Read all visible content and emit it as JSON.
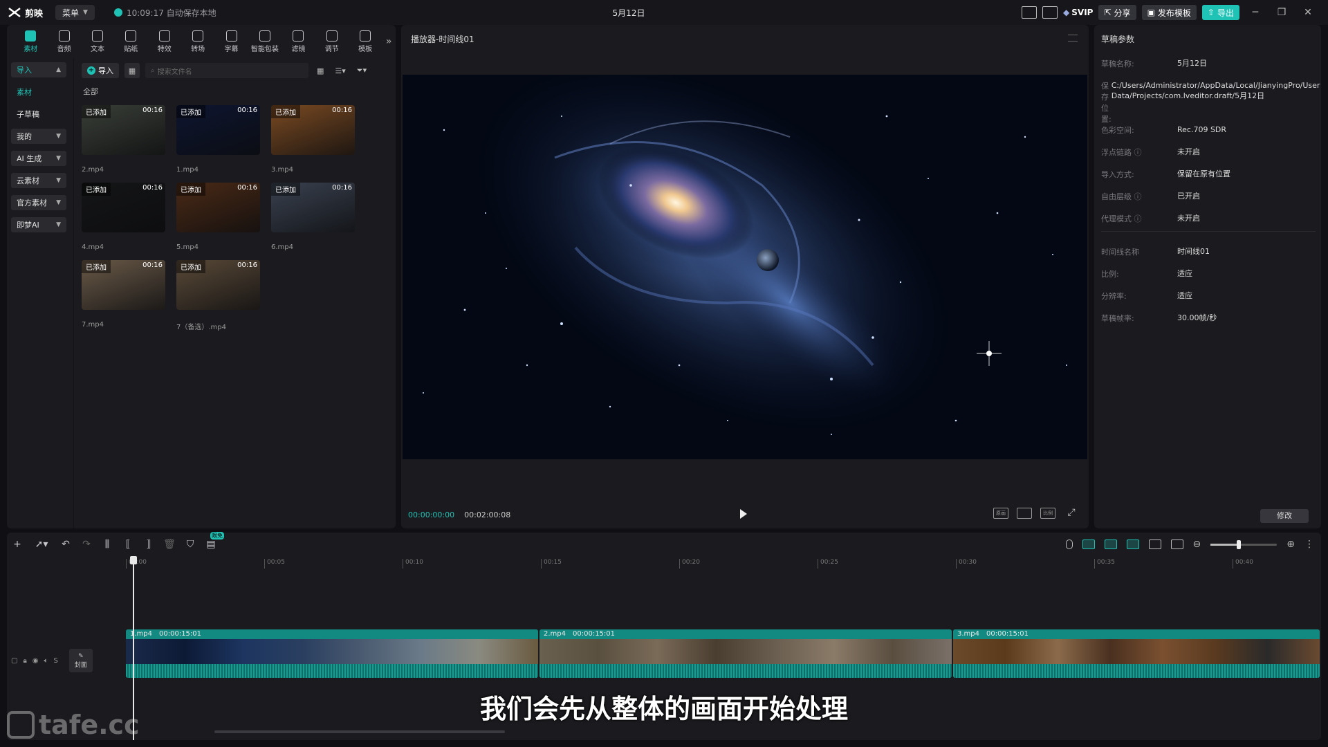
{
  "titlebar": {
    "app_name": "剪映",
    "menu_label": "菜单",
    "autosave": "10:09:17 自动保存本地",
    "title": "5月12日",
    "svip": "SVIP",
    "share": "分享",
    "publish_template": "发布模板",
    "export": "导出"
  },
  "tool_tabs": [
    {
      "label": "素材",
      "icon": "media-icon",
      "active": true
    },
    {
      "label": "音频",
      "icon": "audio-icon"
    },
    {
      "label": "文本",
      "icon": "text-icon"
    },
    {
      "label": "贴纸",
      "icon": "sticker-icon"
    },
    {
      "label": "特效",
      "icon": "effects-icon"
    },
    {
      "label": "转场",
      "icon": "transition-icon"
    },
    {
      "label": "字幕",
      "icon": "caption-icon"
    },
    {
      "label": "智能包装",
      "icon": "smart-pack-icon"
    },
    {
      "label": "滤镜",
      "icon": "filter-icon"
    },
    {
      "label": "调节",
      "icon": "adjust-icon"
    },
    {
      "label": "模板",
      "icon": "template-icon"
    }
  ],
  "side_nav": [
    {
      "label": "导入",
      "group": true,
      "active": true
    },
    {
      "label": "素材",
      "group": false,
      "active": true
    },
    {
      "label": "子草稿",
      "group": false
    },
    {
      "label": "我的",
      "group": true
    },
    {
      "label": "AI 生成",
      "group": true
    },
    {
      "label": "云素材",
      "group": true
    },
    {
      "label": "官方素材",
      "group": true
    },
    {
      "label": "即梦AI",
      "group": true
    }
  ],
  "media": {
    "import_label": "导入",
    "search_placeholder": "搜索文件名",
    "all_label": "全部",
    "clips": [
      {
        "name": "2.mp4",
        "badge": "已添加",
        "duration": "00:16",
        "bg": "#3a3f38"
      },
      {
        "name": "1.mp4",
        "badge": "已添加",
        "duration": "00:16",
        "bg": "#0d1530"
      },
      {
        "name": "3.mp4",
        "badge": "已添加",
        "duration": "00:16",
        "bg": "#7a4a22"
      },
      {
        "name": "4.mp4",
        "badge": "已添加",
        "duration": "00:16",
        "bg": "#141516"
      },
      {
        "name": "5.mp4",
        "badge": "已添加",
        "duration": "00:16",
        "bg": "#4a2a16"
      },
      {
        "name": "6.mp4",
        "badge": "已添加",
        "duration": "00:16",
        "bg": "#3a4250"
      },
      {
        "name": "7.mp4",
        "badge": "已添加",
        "duration": "00:16",
        "bg": "#6a5a48"
      },
      {
        "name": "7（备选）.mp4",
        "badge": "已添加",
        "duration": "00:16",
        "bg": "#5a4a38"
      }
    ]
  },
  "player": {
    "title": "播放器-时间线01",
    "current_time": "00:00:00:00",
    "total_time": "00:02:00:08",
    "tool_original": "原画",
    "tool_ratio": "比例"
  },
  "props": {
    "title": "草稿参数",
    "rows_top": [
      {
        "k": "草稿名称:",
        "v": "5月12日"
      },
      {
        "k": "保存位置:",
        "v": "C:/Users/Administrator/AppData/Local/JianyingPro/User Data/Projects/com.lveditor.draft/5月12日"
      },
      {
        "k": "色彩空间:",
        "v": "Rec.709 SDR"
      },
      {
        "k": "浮点链路 ⓘ",
        "v": "未开启"
      },
      {
        "k": "导入方式:",
        "v": "保留在原有位置"
      },
      {
        "k": "自由层级 ⓘ",
        "v": "已开启"
      },
      {
        "k": "代理模式 ⓘ",
        "v": "未开启"
      }
    ],
    "rows_bottom": [
      {
        "k": "时间线名称",
        "v": "时间线01"
      },
      {
        "k": "比例:",
        "v": "适应"
      },
      {
        "k": "分辨率:",
        "v": "适应"
      },
      {
        "k": "草稿帧率:",
        "v": "30.00帧/秒"
      }
    ],
    "modify": "修改"
  },
  "timeline": {
    "ruler": [
      "00:00",
      "00:05",
      "00:10",
      "00:15",
      "00:20",
      "00:25",
      "00:30",
      "00:35",
      "00:40"
    ],
    "cover_label": "封面",
    "free_badge": "限免",
    "segments": [
      {
        "name": "1.mp4",
        "duration": "00:00:15:01",
        "colors": [
          "#1a2a4a",
          "#0d1a36",
          "#1d3560",
          "#2a3f60",
          "#4a5a70",
          "#6a7a88",
          "#8a8a80",
          "#6a5a40"
        ]
      },
      {
        "name": "2.mp4",
        "duration": "00:00:15:01",
        "colors": [
          "#6a6050",
          "#5a5040",
          "#7a6a58",
          "#4a3e30",
          "#6a5e50",
          "#8a7a68",
          "#5a4e40",
          "#7a7068"
        ]
      },
      {
        "name": "3.mp4",
        "duration": "00:00:15:01",
        "colors": [
          "#6a4a2a",
          "#5a3a1a",
          "#8a6a4a",
          "#4a3020",
          "#7a5030",
          "#5a3a20",
          "#2a2a2a",
          "#6a4a30"
        ]
      }
    ],
    "zoom": 0.42
  },
  "subtitle": "我们会先从整体的画面开始处理",
  "watermark": "tafe.cc"
}
